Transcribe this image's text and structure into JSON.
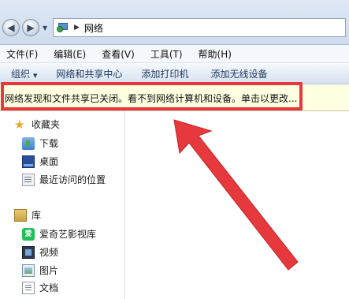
{
  "address": {
    "back_icon": "back-arrow-icon",
    "forward_icon": "forward-arrow-icon",
    "location": "网络"
  },
  "menu": {
    "items": [
      "文件(F)",
      "编辑(E)",
      "查看(V)",
      "工具(T)",
      "帮助(H)"
    ]
  },
  "commands": {
    "organize": "组织",
    "network_sharing_center": "网络和共享中心",
    "add_printer": "添加打印机",
    "add_wireless": "添加无线设备"
  },
  "infobar": {
    "text": "网络发现和文件共享已关闭。看不到网络计算机和设备。单击以更改..."
  },
  "navpane": {
    "favorites": "收藏夹",
    "downloads": "下载",
    "desktop": "桌面",
    "recent": "最近访问的位置",
    "libraries": "库",
    "iqiyi": "爱奇艺影视库",
    "videos": "视频",
    "pictures": "图片",
    "documents": "文档"
  },
  "colors": {
    "highlight": "#e5393d",
    "infobar_bg": "#ffffe1",
    "arrow": "#e5393d"
  }
}
